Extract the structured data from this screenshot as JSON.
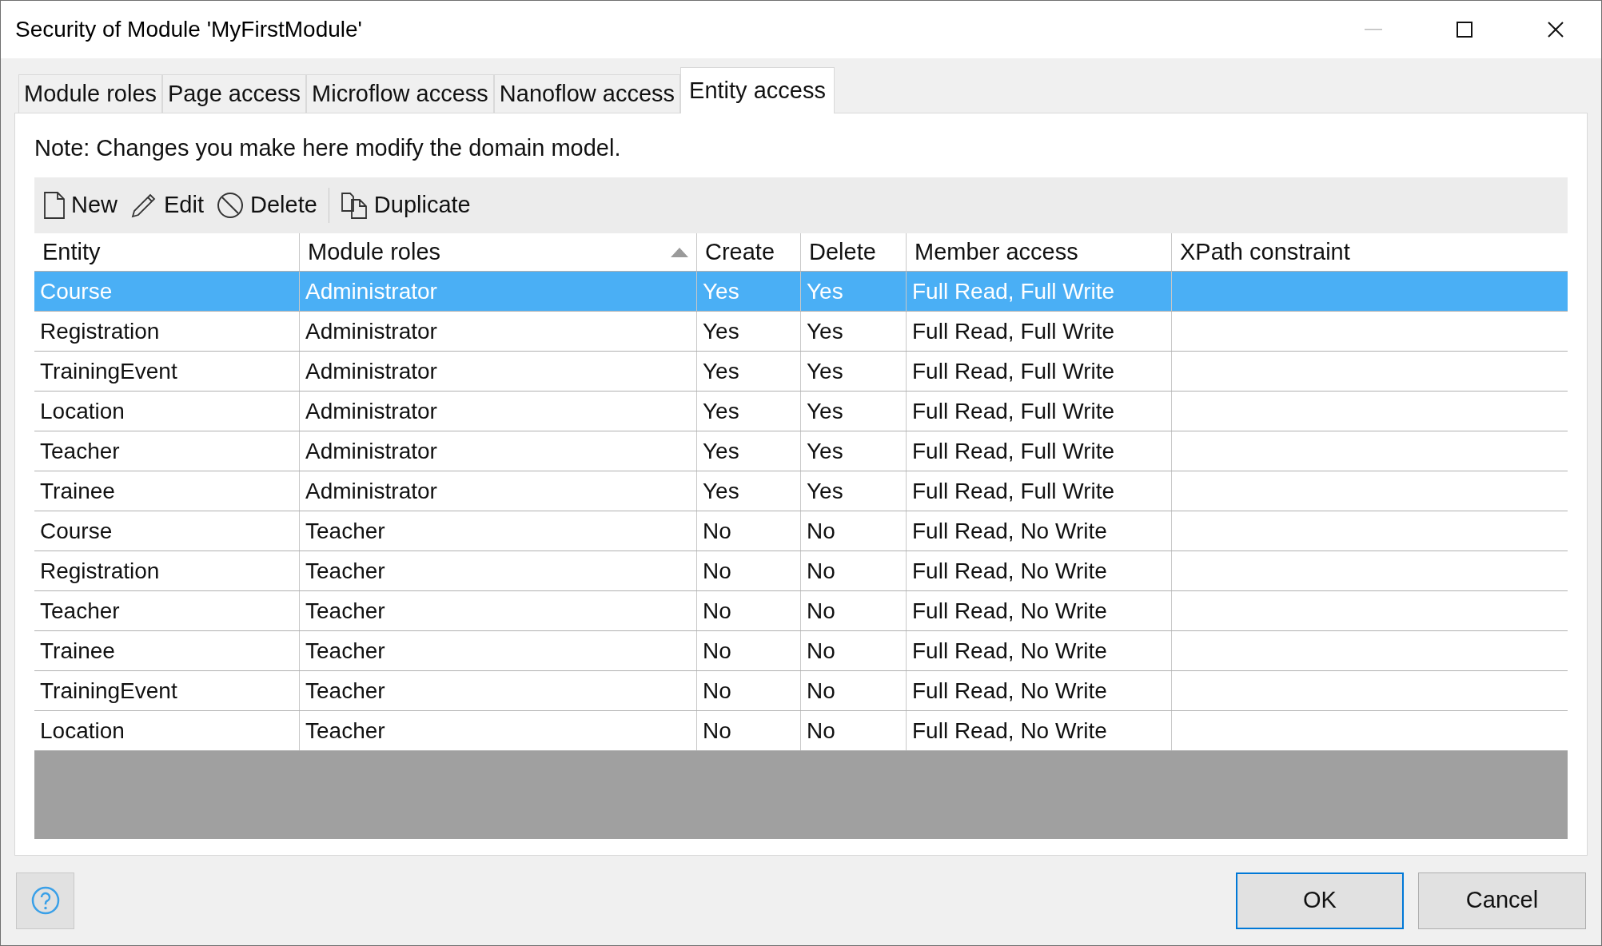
{
  "window": {
    "title": "Security of Module 'MyFirstModule'"
  },
  "tabs": [
    {
      "label": "Module roles",
      "selected": false
    },
    {
      "label": "Page access",
      "selected": false
    },
    {
      "label": "Microflow access",
      "selected": false
    },
    {
      "label": "Nanoflow access",
      "selected": false
    },
    {
      "label": "Entity access",
      "selected": true
    }
  ],
  "note": "Note: Changes you make here modify the domain model.",
  "toolbar": [
    {
      "kind": "new",
      "label": "New"
    },
    {
      "kind": "edit",
      "label": "Edit"
    },
    {
      "kind": "delete",
      "label": "Delete"
    },
    {
      "kind": "duplicate",
      "label": "Duplicate"
    }
  ],
  "table": {
    "columns": [
      {
        "label": "Entity",
        "sorted": false
      },
      {
        "label": "Module roles",
        "sorted": true
      },
      {
        "label": "Create",
        "sorted": false
      },
      {
        "label": "Delete",
        "sorted": false
      },
      {
        "label": "Member access",
        "sorted": false
      },
      {
        "label": "XPath constraint",
        "sorted": false
      }
    ],
    "rows": [
      {
        "cells": [
          "Course",
          "Administrator",
          "Yes",
          "Yes",
          "Full Read, Full Write"
        ],
        "selected": true
      },
      {
        "cells": [
          "Registration",
          "Administrator",
          "Yes",
          "Yes",
          "Full Read, Full Write"
        ],
        "selected": false
      },
      {
        "cells": [
          "TrainingEvent",
          "Administrator",
          "Yes",
          "Yes",
          "Full Read, Full Write"
        ],
        "selected": false
      },
      {
        "cells": [
          "Location",
          "Administrator",
          "Yes",
          "Yes",
          "Full Read, Full Write"
        ],
        "selected": false
      },
      {
        "cells": [
          "Teacher",
          "Administrator",
          "Yes",
          "Yes",
          "Full Read, Full Write"
        ],
        "selected": false
      },
      {
        "cells": [
          "Trainee",
          "Administrator",
          "Yes",
          "Yes",
          "Full Read, Full Write"
        ],
        "selected": false
      },
      {
        "cells": [
          "Course",
          "Teacher",
          "No",
          "No",
          "Full Read, No Write"
        ],
        "selected": false
      },
      {
        "cells": [
          "Registration",
          "Teacher",
          "No",
          "No",
          "Full Read, No Write"
        ],
        "selected": false
      },
      {
        "cells": [
          "Teacher",
          "Teacher",
          "No",
          "No",
          "Full Read, No Write"
        ],
        "selected": false
      },
      {
        "cells": [
          "Trainee",
          "Teacher",
          "No",
          "No",
          "Full Read, No Write"
        ],
        "selected": false
      },
      {
        "cells": [
          "TrainingEvent",
          "Teacher",
          "No",
          "No",
          "Full Read, No Write"
        ],
        "selected": false
      },
      {
        "cells": [
          "Location",
          "Teacher",
          "No",
          "No",
          "Full Read, No Write"
        ],
        "selected": false
      }
    ]
  },
  "buttons": [
    {
      "label": "OK",
      "default": true
    },
    {
      "label": "Cancel",
      "default": false
    }
  ]
}
